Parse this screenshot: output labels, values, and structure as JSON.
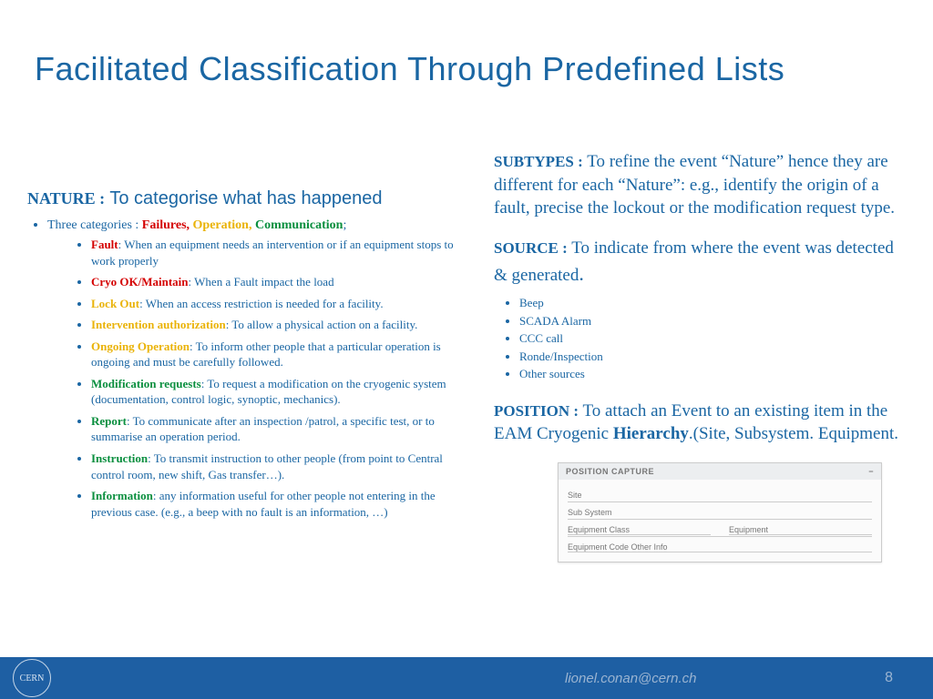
{
  "title": "Facilitated Classification Through Predefined Lists",
  "nature": {
    "label": "NATURE :",
    "desc": "To categorise what has happened",
    "cats_lead": "Three categories :",
    "cat_fail": "Failures,",
    "cat_op": "Operation,",
    "cat_comm": "Communication",
    "semi": ";",
    "items": [
      {
        "cls": "red",
        "term": "Fault",
        "desc": ": When an equipment needs an intervention or if an equipment stops to work properly"
      },
      {
        "cls": "red",
        "term": "Cryo OK/Maintain",
        "desc": ": When a Fault impact the load"
      },
      {
        "cls": "yellow",
        "term": "Lock Out",
        "desc": ": When an access restriction is needed for a facility."
      },
      {
        "cls": "yellow",
        "term": "Intervention authorization",
        "desc": ": To allow a physical action on a facility."
      },
      {
        "cls": "yellow",
        "term": "Ongoing Operation",
        "desc": ": To inform other people that a particular operation is ongoing and must be carefully followed."
      },
      {
        "cls": "green",
        "term": "Modification requests",
        "desc": ": To request a modification on the cryogenic system (documentation, control logic, synoptic, mechanics)."
      },
      {
        "cls": "green",
        "term": "Report",
        "desc": ": To communicate after an inspection /patrol, a specific test, or to summarise an operation period."
      },
      {
        "cls": "green",
        "term": "Instruction",
        "desc": ": To transmit instruction to other people (from point to Central control room, new shift, Gas transfer…)."
      },
      {
        "cls": "green",
        "term": "Information",
        "desc": ": any information useful for other people not entering in the previous case.  (e.g., a beep with no fault is an information, …)"
      }
    ]
  },
  "subtypes": {
    "label": "SUBTYPES  :",
    "desc": "To refine the event “Nature” hence they are different for each “Nature”: e.g., identify the origin of a fault, precise the lockout or the modification request type."
  },
  "source": {
    "label": "SOURCE  :",
    "desc": "To indicate from where the event was detected & generated",
    "dot": ".",
    "items": [
      "Beep",
      "SCADA Alarm",
      "CCC call",
      "Ronde/Inspection",
      "Other sources"
    ]
  },
  "position": {
    "label": "POSITION  :",
    "desc_a": "To attach an Event to an existing item in the EAM Cryogenic ",
    "hier": "Hierarchy",
    "desc_b": ".(Site, Subsystem. Equipment."
  },
  "posbox": {
    "header": "POSITION CAPTURE",
    "minus": "−",
    "r1": "Site",
    "r2": "Sub System",
    "r3a": "Equipment Class",
    "r3b": "Equipment",
    "r4": "Equipment Code Other Info"
  },
  "footer": {
    "logo": "CERN",
    "email": "lionel.conan@cern.ch",
    "page": "8"
  }
}
